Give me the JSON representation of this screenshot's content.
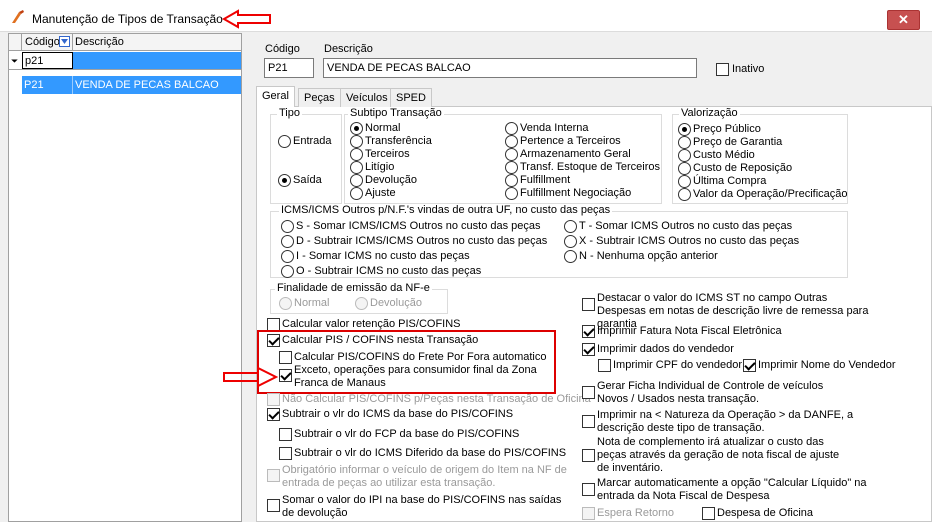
{
  "window": {
    "title": "Manutenção de Tipos de Transação",
    "close_label": "✕"
  },
  "grid": {
    "col_codigo": "Código",
    "col_descricao": "Descrição",
    "filter_value": "p21",
    "rows": [
      {
        "codigo": "P21",
        "descricao": "VENDA DE PECAS BALCAO"
      }
    ]
  },
  "header": {
    "codigo_label": "Código",
    "descricao_label": "Descrição",
    "codigo_value": "P21",
    "descricao_value": "VENDA DE PECAS BALCAO",
    "inativo_label": "Inativo"
  },
  "tabs": [
    "Geral",
    "Peças",
    "Veículos",
    "SPED"
  ],
  "tipo": {
    "title": "Tipo",
    "entrada": "Entrada",
    "saida": "Saída"
  },
  "subtipo": {
    "title": "Subtipo Transação",
    "col1": [
      "Normal",
      "Transferência",
      "Terceiros",
      "Litígio",
      "Devolução",
      "Ajuste"
    ],
    "col2": [
      "Venda Interna",
      "Pertence a Terceiros",
      "Armazenamento Geral",
      "Transf. Estoque de Terceiros",
      "Fulfillment",
      "Fulfillment Negociação"
    ]
  },
  "valorizacao": {
    "title": "Valorização",
    "items": [
      "Preço Público",
      "Preço de Garantia",
      "Custo Médio",
      "Custo de Reposição",
      "Última Compra",
      "Valor da Operação/Precificação"
    ]
  },
  "icms": {
    "title": "ICMS/ICMS Outros p/N.F.'s vindas de outra UF, no custo das peças",
    "left": [
      "S - Somar ICMS/ICMS Outros no custo das peças",
      "D - Subtrair ICMS/ICMS Outros no custo das peças",
      "I - Somar ICMS no custo das peças",
      "O - Subtrair ICMS no custo das peças"
    ],
    "right": [
      "T - Somar ICMS Outros no custo das peças",
      "X - Subtrair ICMS Outros no custo das peças",
      "N - Nenhuma opção anterior"
    ]
  },
  "finalidade": {
    "title": "Finalidade de emissão da NF-e",
    "normal": "Normal",
    "devolucao": "Devolução"
  },
  "left_checks": {
    "retencao": "Calcular valor retenção PIS/COFINS",
    "calc_pis": "Calcular PIS / COFINS nesta Transação",
    "frete": "Calcular PIS/COFINS do Frete Por Fora automatico",
    "exceto": "Exceto, operações para consumidor final da Zona Franca de Manaus",
    "nao_calc": "Não Calcular PIS/COFINS p/Peças nesta Transação de Oficina",
    "subtrair_icms": "Subtrair o vlr do ICMS da base do PIS/COFINS",
    "subtrair_fcp": "Subtrair o vlr do FCP da base do PIS/COFINS",
    "subtrair_difer": "Subtrair o vlr do ICMS Diferido da base do PIS/COFINS",
    "obrigatorio": "Obrigatório informar o veículo de origem do Item na NF de entrada de peças ao utilizar esta transação.",
    "somar_ipi": "Somar o valor do IPI na base do PIS/COFINS nas saídas de devolução"
  },
  "right_checks": {
    "destacar": "Destacar o valor do ICMS ST no campo Outras Despesas em notas de descrição livre de remessa para garantia",
    "fatura": "Imprimir Fatura Nota Fiscal Eletrônica",
    "vendedor": "Imprimir dados do vendedor",
    "cpf": "Imprimir CPF do vendedor",
    "nome": "Imprimir Nome do Vendedor",
    "ficha": "Gerar Ficha Individual de Controle de veículos Novos / Usados  nesta transação.",
    "natureza": "Imprimir na < Natureza da Operação > da DANFE, a descrição deste tipo de transação.",
    "complemento": "Nota de complemento irá atualizar o custo das peças através da geração de nota fiscal de ajuste de inventário.",
    "marcar": "Marcar automaticamente a opção \"Calcular Líquido\" na entrada da Nota Fiscal de Despesa",
    "espera": "Espera Retorno",
    "despesa": "Despesa de Oficina"
  },
  "colors": {
    "selection": "#3399ff",
    "highlight_box": "#dd0000",
    "close": "#c75050"
  }
}
